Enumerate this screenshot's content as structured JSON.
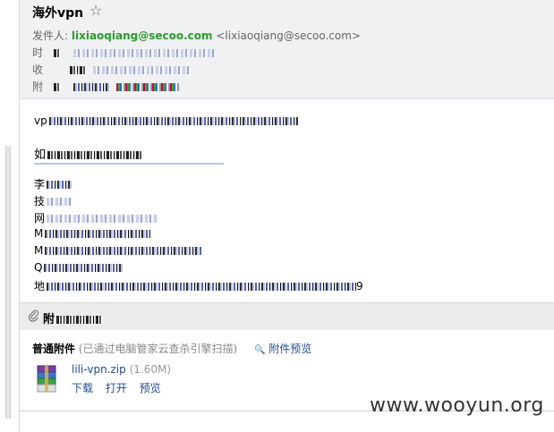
{
  "header": {
    "subject": "海外vpn",
    "star_icon": "☆",
    "from_label": "发件人:",
    "from_name": "lixiaoqiang@secoo.com",
    "from_address": "<lixiaoqiang@secoo.com>",
    "time_label": "时",
    "to_label": "收",
    "attach_label": "附"
  },
  "body": {
    "line1_start": "vp",
    "line2_start": "如",
    "sig_line1": "李",
    "sig_line2": "技",
    "sig_line3": "网",
    "sig_line4": "M",
    "sig_line5": "M",
    "sig_line6": "Q",
    "sig_line7_start": "地",
    "sig_line7_end": "9"
  },
  "attachments_bar": {
    "clip_icon": "paperclip-icon",
    "title": "附"
  },
  "attachments": {
    "section_title": "普通附件",
    "scan_note": "(已通过电脑管家云查杀引擎扫描)",
    "preview_label": "附件预览",
    "search_icon": "🔍",
    "file": {
      "name": "lili-vpn.zip",
      "size": "(1.60M)",
      "download": "下载",
      "open": "打开",
      "preview": "预览"
    }
  },
  "watermark": "www.wooyun.org"
}
